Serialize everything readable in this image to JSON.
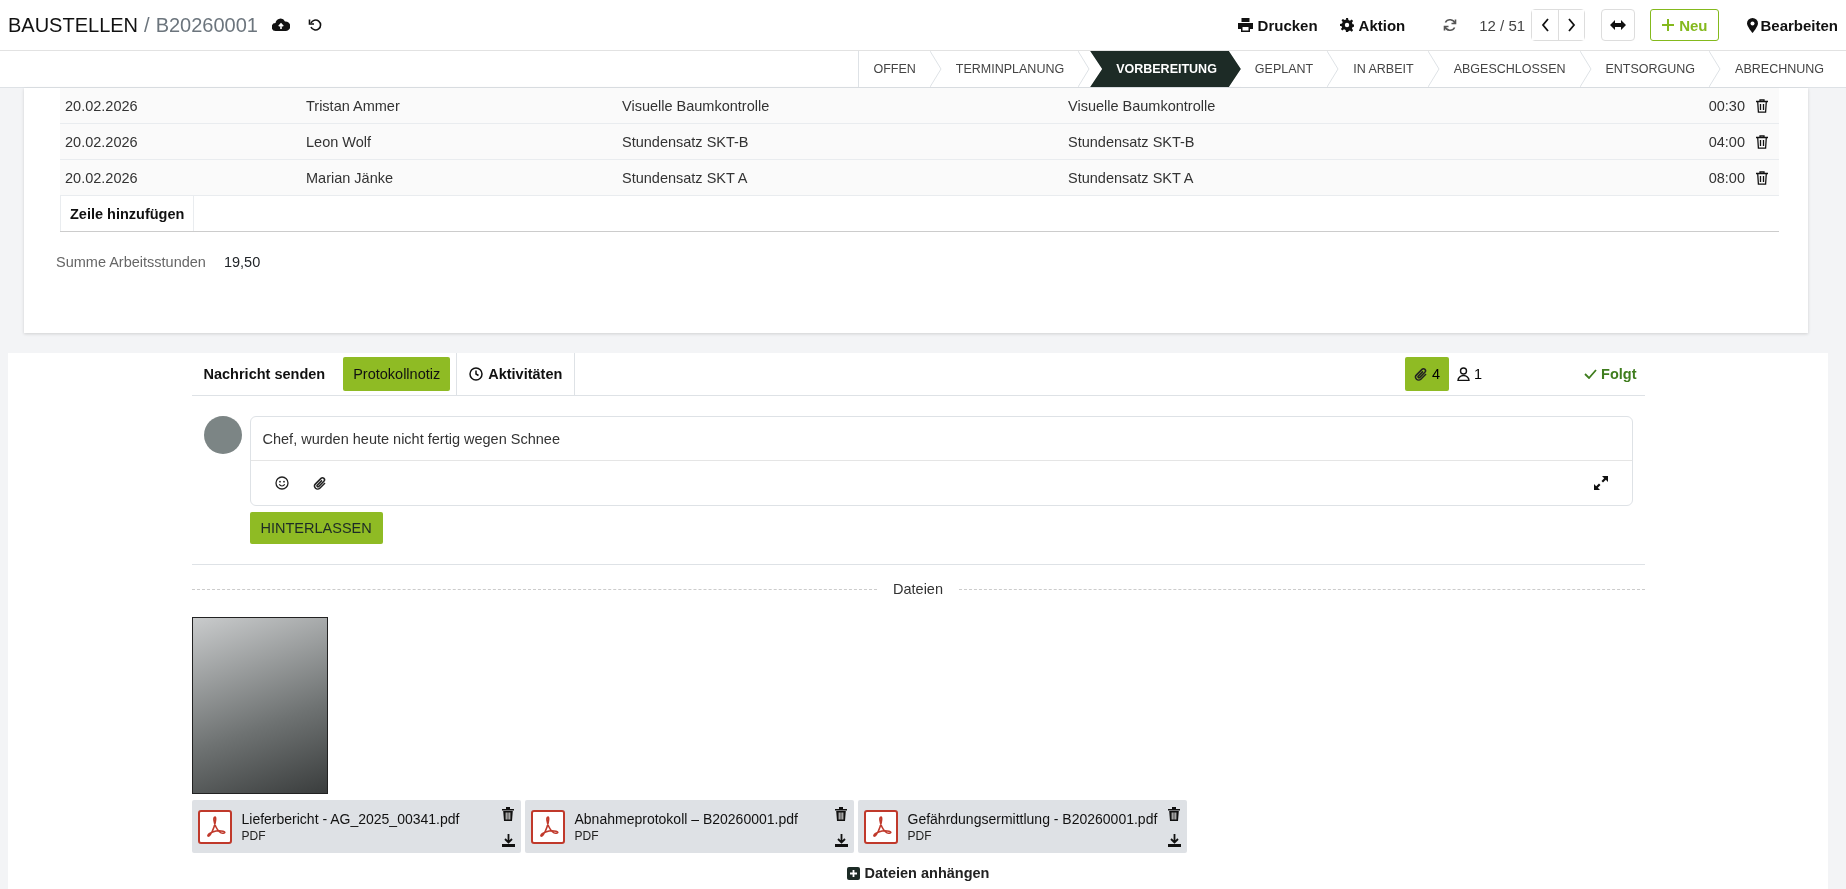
{
  "header": {
    "breadcrumb": "BAUSTELLEN",
    "separator": "/",
    "record": "B20260001",
    "print": "Drucken",
    "action": "Aktion",
    "pager": "12 / 51",
    "new": "Neu",
    "edit": "Bearbeiten"
  },
  "stages": [
    {
      "label": "OFFEN",
      "selected": false
    },
    {
      "label": "TERMINPLANUNG",
      "selected": false
    },
    {
      "label": "VORBEREITUNG",
      "selected": true
    },
    {
      "label": "GEPLANT",
      "selected": false
    },
    {
      "label": "IN ARBEIT",
      "selected": false
    },
    {
      "label": "ABGESCHLOSSEN",
      "selected": false
    },
    {
      "label": "ENTSORGUNG",
      "selected": false
    },
    {
      "label": "ABRECHNUNG",
      "selected": false
    }
  ],
  "table": {
    "rows": [
      {
        "date": "20.02.2026",
        "employee": "Tristan Ammer",
        "product": "Visuelle Baumkontrolle",
        "description": "Visuelle Baumkontrolle",
        "hours": "00:30"
      },
      {
        "date": "20.02.2026",
        "employee": "Leon Wolf",
        "product": "Stundensatz SKT-B",
        "description": "Stundensatz SKT-B",
        "hours": "04:00"
      },
      {
        "date": "20.02.2026",
        "employee": "Marian Jänke",
        "product": "Stundensatz SKT A",
        "description": "Stundensatz SKT A",
        "hours": "08:00"
      }
    ],
    "add_line": "Zeile hinzufügen"
  },
  "total": {
    "label": "Summe Arbeitsstunden",
    "value": "19,50"
  },
  "chatter": {
    "tabs": [
      {
        "label": "Nachricht senden",
        "kind": "message",
        "selected": false
      },
      {
        "label": "Protokollnotiz",
        "kind": "note",
        "selected": true
      },
      {
        "label": "Aktivitäten",
        "kind": "activity",
        "selected": false
      }
    ],
    "attachments_count": "4",
    "followers_count": "1",
    "follow": "Folgt",
    "composer": {
      "value": "Chef, wurden heute nicht fertig wegen Schnee"
    },
    "submit": "HINTERLASSEN"
  },
  "files": {
    "title": "Dateien",
    "documents": [
      {
        "name": "Lieferbericht - AG_2025_00341.pdf",
        "type": "PDF"
      },
      {
        "name": "Abnahmeprotokoll – B20260001.pdf",
        "type": "PDF"
      },
      {
        "name": "Gefährdungsermittlung - B20260001.pdf",
        "type": "PDF"
      }
    ],
    "attach": "Dateien anhängen"
  }
}
